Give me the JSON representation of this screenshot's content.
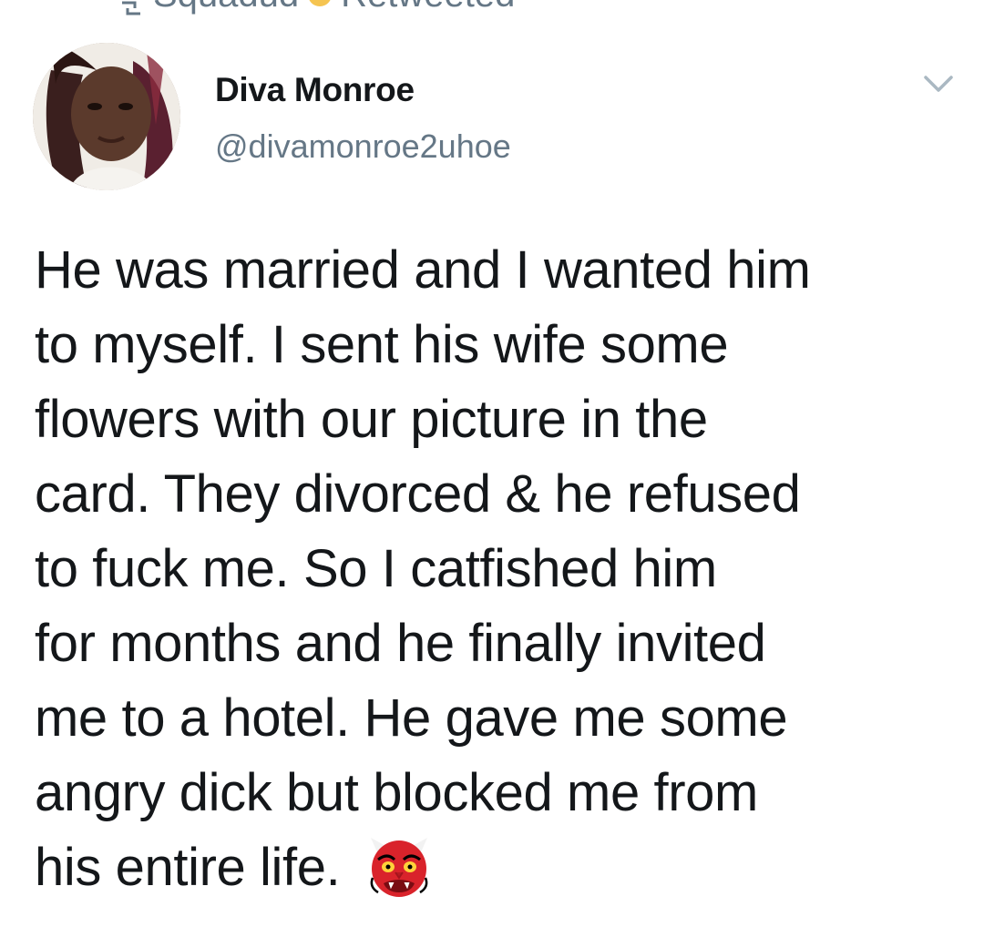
{
  "retweet": {
    "icon": "retweet-icon",
    "text": "Squadud",
    "badge_icon": "heart-badge-icon",
    "suffix": "Retweeted"
  },
  "author": {
    "display_name": "Diva Monroe",
    "handle": "@divamonroe2uhoe",
    "avatar_icon": "profile-photo"
  },
  "menu": {
    "icon": "chevron-down-icon"
  },
  "tweet": {
    "lines": [
      "He was married and I wanted him",
      "to myself. I sent his wife some",
      "flowers with our picture in the",
      "card. They divorced & he refused",
      "to fuck me. So I catfished him",
      "for months and he finally invited",
      "me to a hotel. He gave me some",
      "angry dick but blocked me from",
      "his entire life."
    ],
    "emoji": "goblin-mask-emoji"
  },
  "colors": {
    "text": "#14171a",
    "secondary": "#657786",
    "emoji_red": "#d9232b"
  }
}
